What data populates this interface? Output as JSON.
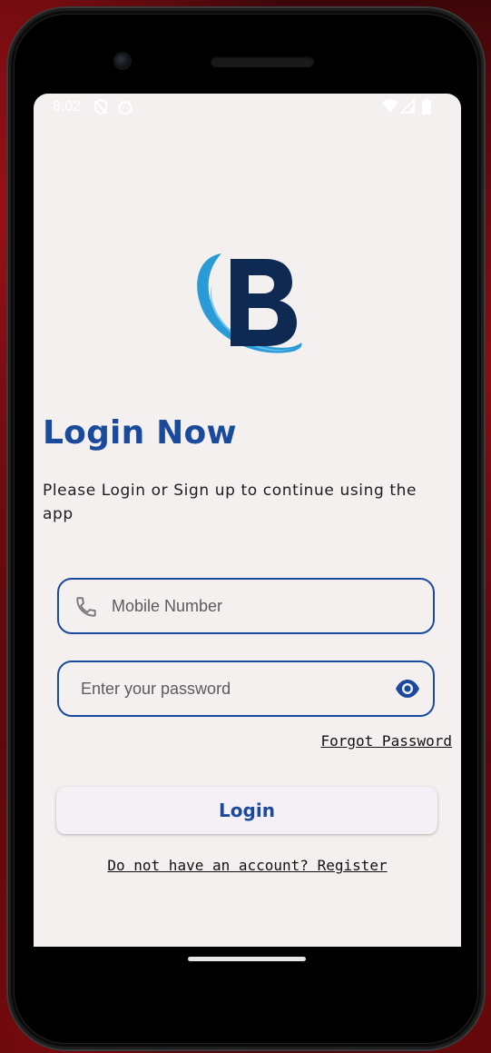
{
  "status_bar": {
    "time": "8:02",
    "left_icons": [
      "shield-slash-icon",
      "face-icon"
    ],
    "right_icons": [
      "wifi-icon",
      "signal-icon",
      "battery-icon"
    ]
  },
  "brand": {
    "logo_letter": "B",
    "logo_icon": "brand-logo-icon",
    "navy": "#0f2a52",
    "swoosh": "#2a9bd7"
  },
  "login": {
    "title": "Login Now",
    "subtitle": "Please Login or Sign up to continue using the app",
    "mobile_placeholder": "Mobile Number",
    "mobile_icon": "phone-icon",
    "password_placeholder": "Enter your password",
    "password_icon": "eye-icon",
    "forgot_label": "Forgot Password",
    "login_label": "Login",
    "register_label": "Do not have an account? Register"
  },
  "colors": {
    "accent": "#1a4a9c",
    "screen_background": "#f4f0f0"
  }
}
